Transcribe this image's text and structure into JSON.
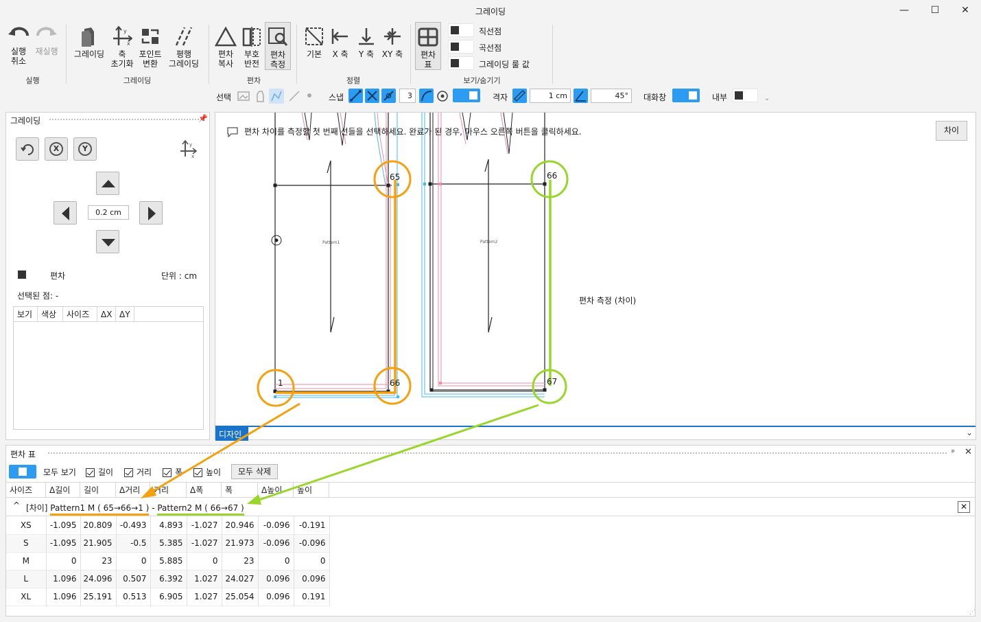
{
  "window": {
    "title": "그레이딩",
    "minimize": "—",
    "maximize": "☐",
    "close": "✕"
  },
  "ribbon": {
    "undo": "실행\n취소",
    "redo": "재실행",
    "grading": "그레이딩",
    "axis_reset": "축\n초기화",
    "point_convert": "포인트\n변환",
    "parallel_grading": "평행\n그레이딩",
    "dev_copy": "편차\n복사",
    "sign_flip": "부호\n반전",
    "dev_measure": "편차\n측정",
    "basic": "기본",
    "x_axis": "X 축",
    "y_axis": "Y 축",
    "xy_axis": "XY 축",
    "dev_table": "편차\n표",
    "show_straight": "직선점",
    "show_curve": "곡선점",
    "show_grading_value": "그레이딩 룰 값",
    "groups": {
      "run": "실행",
      "grading": "그레이딩",
      "deviation": "편차",
      "align": "정렬",
      "show_hide": "보기/숨기기"
    }
  },
  "toolbar2": {
    "select_label": "선택",
    "snap_label": "스냅",
    "snap_value": "3",
    "grid_label": "격자",
    "grid_value": "1 cm",
    "angle_value": "45°",
    "dialog_label": "대화창",
    "inner_label": "내부"
  },
  "left_panel": {
    "title": "그레이딩",
    "step_value": "0.2 cm",
    "dev_label": "편차",
    "unit_label": "단위 : cm",
    "selected_point": "선택된 점: -",
    "columns": [
      "보기",
      "색상",
      "사이즈",
      "ΔX",
      "ΔY"
    ]
  },
  "canvas": {
    "instruction": "편차 차이를 측정할 첫 번째 선들을 선택하세요. 완료가 된 경우, 마우스 오른쪽 버튼을 클릭하세요.",
    "diff_button": "차이",
    "measure_label": "편차 측정 (차이)",
    "pattern1": "Pattern1",
    "pattern2": "Pattern2",
    "point_labels": [
      "65",
      "66",
      "1",
      "66",
      "67"
    ],
    "tab_label": "디자인"
  },
  "dev_panel": {
    "title": "편차 표",
    "show_all": "모두 보기",
    "length": "길이",
    "distance": "거리",
    "width": "폭",
    "height": "높이",
    "delete_all": "모두 삭제",
    "columns": [
      "사이즈",
      "Δ길이",
      "길이",
      "Δ거리",
      "거리",
      "Δ폭",
      "폭",
      "Δ높이",
      "높이"
    ],
    "group_prefix": "[차이]",
    "group_a": "Pattern1 M ( 65→66→1 )",
    "group_sep": "-",
    "group_b": "Pattern2 M ( 66→67 )",
    "rows": [
      [
        "XS",
        "-1.095",
        "20.809",
        "-0.493",
        "4.893",
        "-1.027",
        "20.946",
        "-0.096",
        "-0.191"
      ],
      [
        "S",
        "-1.095",
        "21.905",
        "-0.5",
        "5.385",
        "-1.027",
        "21.973",
        "-0.096",
        "-0.096"
      ],
      [
        "M",
        "0",
        "23",
        "0",
        "5.885",
        "0",
        "23",
        "0",
        "0"
      ],
      [
        "L",
        "1.096",
        "24.096",
        "0.507",
        "6.392",
        "1.027",
        "24.027",
        "0.096",
        "0.096"
      ],
      [
        "XL",
        "1.096",
        "25.191",
        "0.513",
        "6.905",
        "1.027",
        "25.054",
        "0.096",
        "0.191"
      ]
    ]
  },
  "colors": {
    "accent": "#2b9cf2",
    "orange": "#f5a00e",
    "green": "#98d62a"
  }
}
